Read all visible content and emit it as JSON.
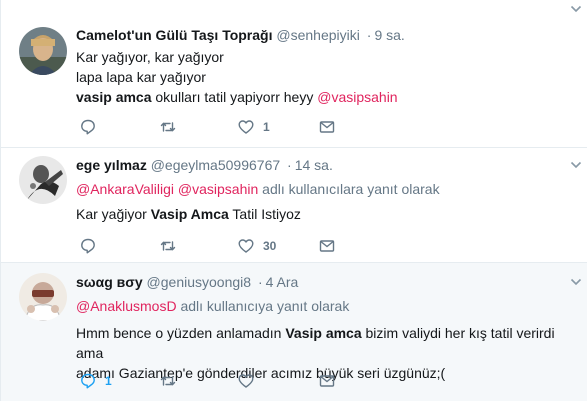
{
  "tweets": [
    {
      "name": "Camelot'un Gülü Taşı Toprağı",
      "handle": "@senhepiyiki",
      "dot": "·",
      "time": "9 sa.",
      "lines": [
        "Kar yağıyor, kar yağıyor",
        "lapa lapa kar yağıyor"
      ],
      "line3_bold": "vasip amca",
      "line3_text": " okulları tatil yapiyorr heyy ",
      "line3_mention": "@vasipsahin",
      "reply_count": "",
      "retweet_count": "",
      "like_count": "1"
    },
    {
      "name": "ege yılmaz",
      "handle": "@egeylma50996767",
      "dot": "·",
      "time": "14 sa.",
      "reply_to_mention1": "@AnkaraValiligi",
      "reply_to_mention2": "@vasipsahin",
      "reply_to_suffix": " adlı kullanıcılara yanıt olarak",
      "text_pre": "Kar yağiyor ",
      "text_bold": "Vasip Amca",
      "text_post": " Tatil Istiyoz",
      "reply_count": "",
      "retweet_count": "",
      "like_count": "30"
    },
    {
      "name": "ѕωαg вσу",
      "handle": "@geniusyoongi8",
      "dot": "·",
      "time": "4 Ara",
      "reply_to_mention": "@AnaklusmosD",
      "reply_to_suffix": " adlı kullanıcıya yanıt olarak",
      "text_pre": "Hmm bence o yüzden anlamadın ",
      "text_bold": "Vasip amca",
      "text_post": " bizim valiydi her kış tatil verirdi ama",
      "text_line2": "adamı Gaziantep'e gönderdiler acımız büyük seri üzgünüz;(",
      "reply_count": "1",
      "retweet_count": "",
      "like_count": ""
    }
  ],
  "colors": {
    "accent": "#1da1f2",
    "mention": "#e0245e",
    "muted": "#657786",
    "text": "#14171a"
  },
  "icons": [
    "reply-icon",
    "retweet-icon",
    "like-icon",
    "direct-message-icon",
    "chevron-down-icon"
  ]
}
